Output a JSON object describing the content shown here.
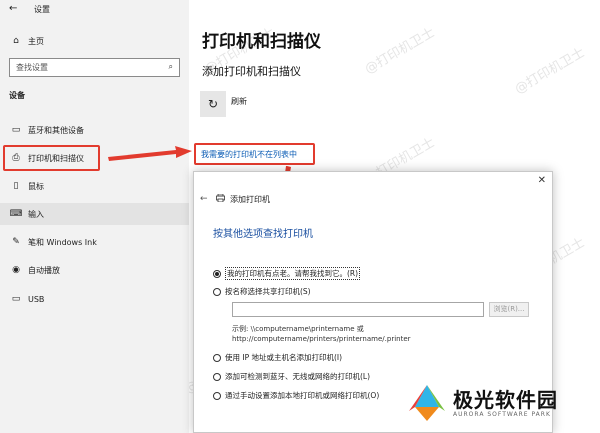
{
  "window": {
    "title": "设置"
  },
  "sidebar": {
    "home": "主页",
    "search_placeholder": "查找设置",
    "section": "设备",
    "items": [
      {
        "label": "蓝牙和其他设备",
        "icon": "bluetooth-devices-icon"
      },
      {
        "label": "打印机和扫描仪",
        "icon": "printer-icon"
      },
      {
        "label": "鼠标",
        "icon": "mouse-icon"
      },
      {
        "label": "输入",
        "icon": "keyboard-icon"
      },
      {
        "label": "笔和 Windows Ink",
        "icon": "pen-icon"
      },
      {
        "label": "自动播放",
        "icon": "autoplay-icon"
      },
      {
        "label": "USB",
        "icon": "usb-icon"
      }
    ]
  },
  "main": {
    "title": "打印机和扫描仪",
    "subtitle": "添加打印机和扫描仪",
    "refresh_label": "刷新",
    "missing_link": "我需要的打印机不在列表中"
  },
  "dialog": {
    "header": "添加打印机",
    "title": "按其他选项查找打印机",
    "options": [
      "我的打印机有点老。请帮我找到它。(R)",
      "按名称选择共享打印机(S)",
      "使用 IP 地址或主机名添加打印机(I)",
      "添加可检测到蓝牙、无线或网络的打印机(L)",
      "通过手动设置添加本地打印机或网络打印机(O)"
    ],
    "selected_option": 0,
    "share_input_value": "",
    "browse_label": "浏览(R)...",
    "example_line1": "示例: \\\\computername\\printername 或",
    "example_line2": "http://computername/printers/printername/.printer"
  },
  "watermark": "@打印机卫士",
  "brand": {
    "name": "极光软件园",
    "sub": "AURORA SOFTWARE PARK"
  },
  "colors": {
    "highlight": "#e23b2e",
    "link": "#0b5cb5",
    "dialog_title": "#1a4fa0"
  }
}
